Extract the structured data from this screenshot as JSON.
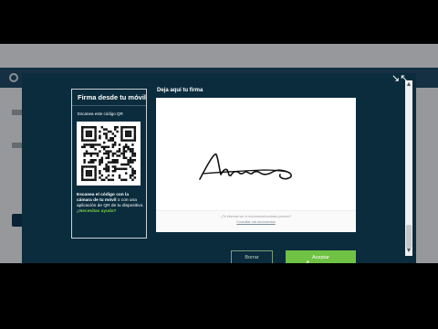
{
  "mobile": {
    "title": "Firma desde tu móvil",
    "scan_label": "Escanea este código QR",
    "instruction_bold": "Escanea el código con la cámara de tu móvil",
    "instruction_rest": " o con una aplicación de QR de tu dispositivo.",
    "help_link": "¿Necesitas ayuda?"
  },
  "signature": {
    "label": "Deja aquí tu firma",
    "footer_question": "¿Te interesa ver el documento/contrato primero?",
    "footer_link": "Consultar mis documentos"
  },
  "buttons": {
    "clear_label": "Borrar",
    "accept_label": "Aceptar"
  },
  "colors": {
    "modal_bg": "#0b2c3d",
    "accept_green": "#6fc243",
    "help_green": "#7cd04a"
  },
  "icons": {
    "collapse": "collapse-arrows-icon",
    "cursor": "mouse-pointer-icon"
  }
}
